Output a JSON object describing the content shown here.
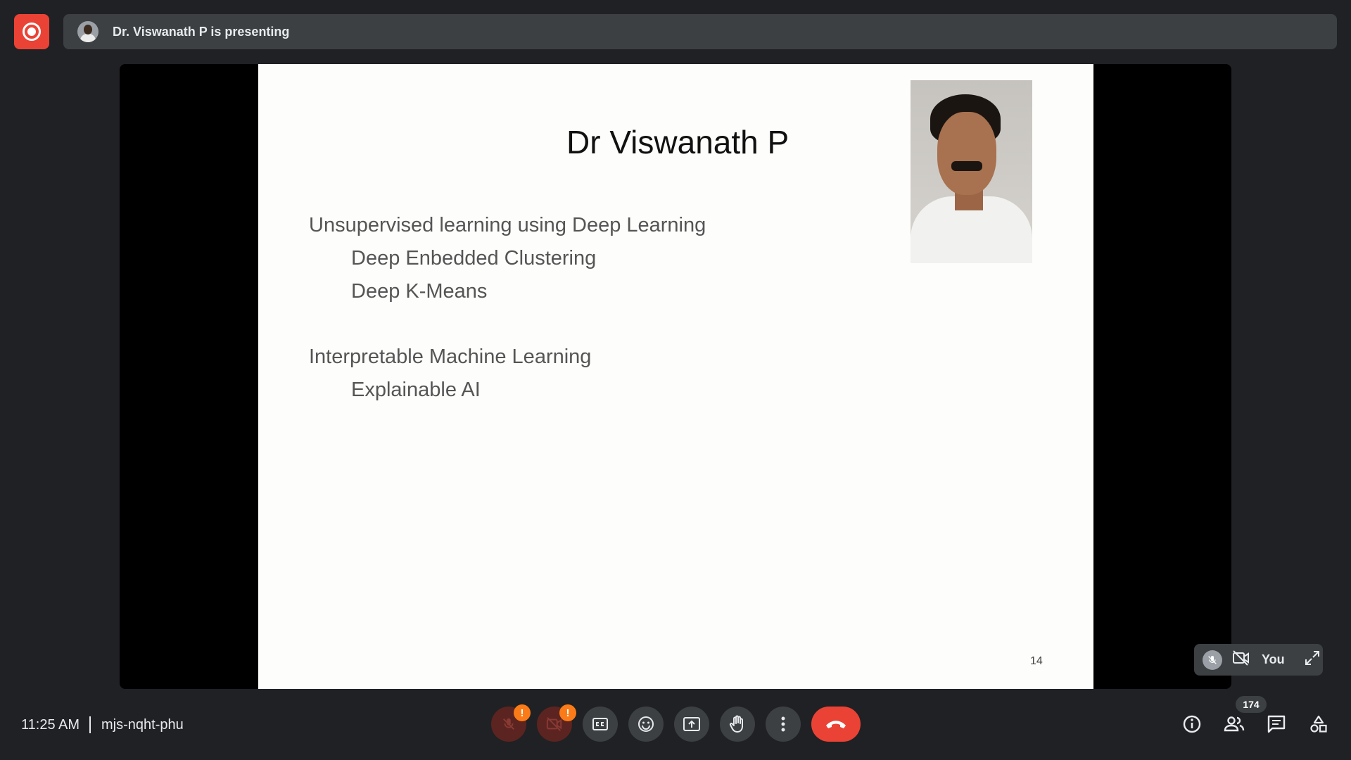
{
  "top_bar": {
    "presenting_text": "Dr. Viswanath P is presenting"
  },
  "slide": {
    "title": "Dr Viswanath P",
    "lines": [
      "Unsupervised learning using Deep Learning",
      "Deep Enbedded Clustering",
      "Deep K-Means",
      "Interpretable Machine Learning",
      "Explainable AI"
    ],
    "page_number": "14"
  },
  "self_view": {
    "name": "You"
  },
  "meeting": {
    "time": "11:25 AM",
    "code": "mjs-nqht-phu"
  },
  "controls": {
    "mic_warning": "!",
    "camera_warning": "!",
    "participant_count": "174"
  },
  "colors": {
    "background": "#202124",
    "surface": "#3c4043",
    "end_call": "#ea4335",
    "warning": "#fa7b17"
  }
}
